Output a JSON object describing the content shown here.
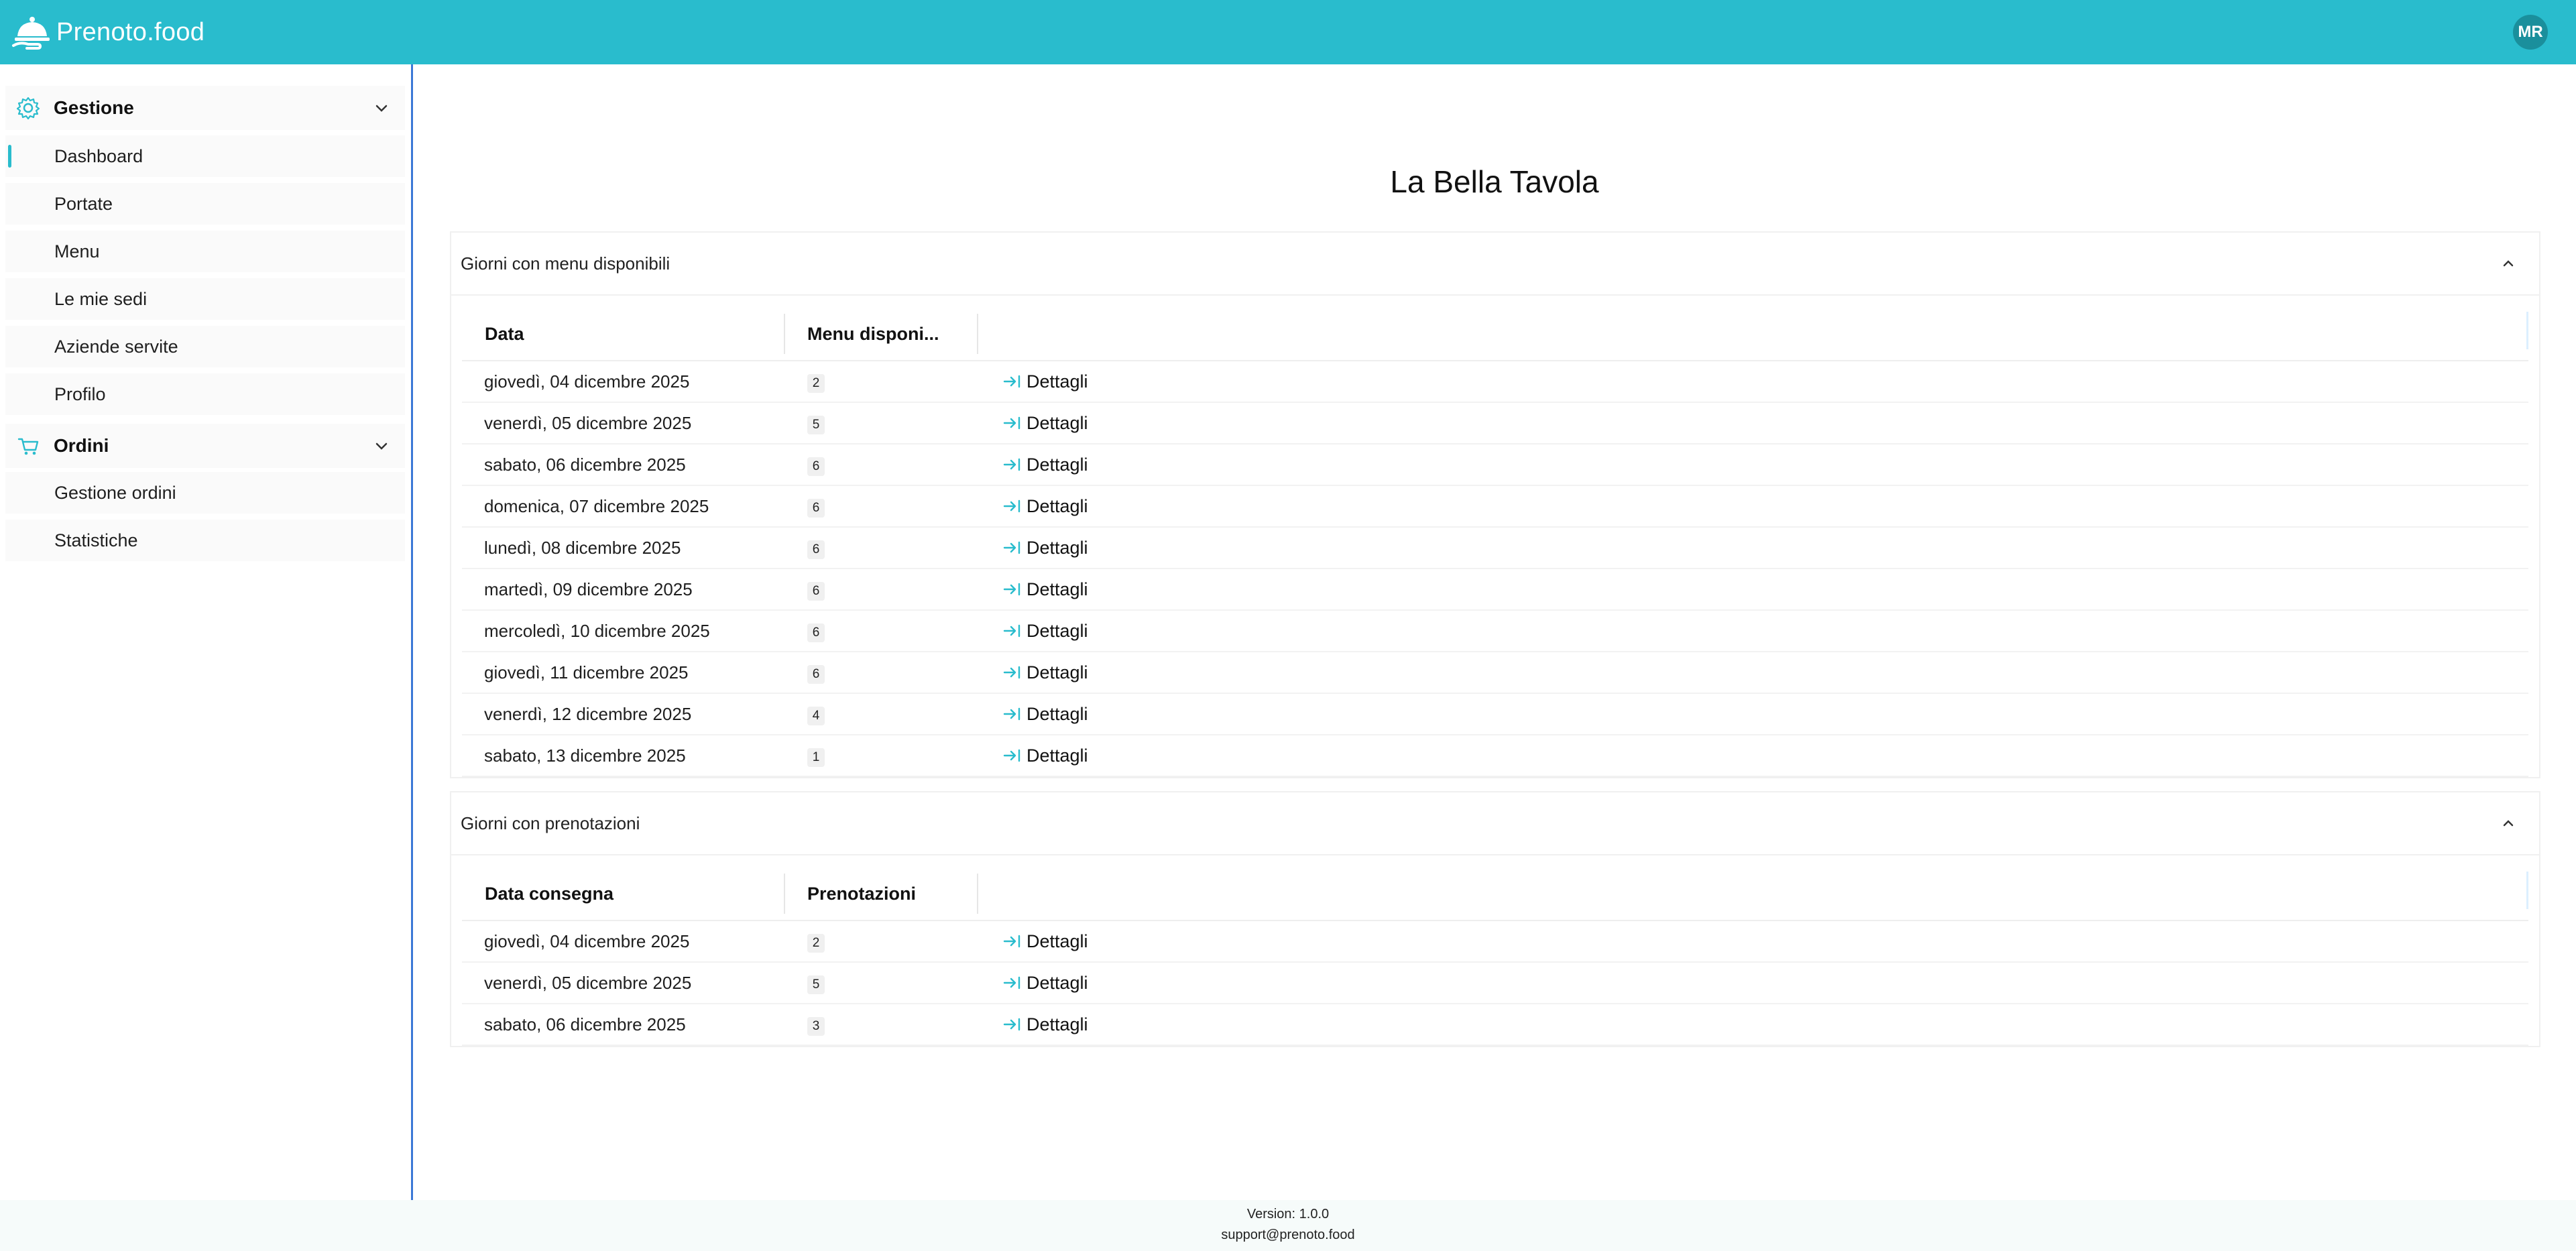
{
  "header": {
    "brand_name": "Prenoto.food",
    "avatar_initials": "MR",
    "color": "#29bccd"
  },
  "sidebar": {
    "groups": [
      {
        "label": "Gestione",
        "icon": "gear-icon",
        "items": [
          "Dashboard",
          "Portate",
          "Menu",
          "Le mie sedi",
          "Aziende servite",
          "Profilo"
        ]
      },
      {
        "label": "Ordini",
        "icon": "cart-icon",
        "items": [
          "Gestione ordini",
          "Statistiche"
        ]
      }
    ],
    "active_item": "Dashboard"
  },
  "main": {
    "title": "La Bella Tavola",
    "menu_panel": {
      "title": "Giorni con menu disponibili",
      "columns": [
        "Data",
        "Menu disponi..."
      ],
      "action_label": "Dettagli",
      "rows": [
        {
          "date": "giovedì, 04 dicembre 2025",
          "count": "2"
        },
        {
          "date": "venerdì, 05 dicembre 2025",
          "count": "5"
        },
        {
          "date": "sabato, 06 dicembre 2025",
          "count": "6"
        },
        {
          "date": "domenica, 07 dicembre 2025",
          "count": "6"
        },
        {
          "date": "lunedì, 08 dicembre 2025",
          "count": "6"
        },
        {
          "date": "martedì, 09 dicembre 2025",
          "count": "6"
        },
        {
          "date": "mercoledì, 10 dicembre 2025",
          "count": "6"
        },
        {
          "date": "giovedì, 11 dicembre 2025",
          "count": "6"
        },
        {
          "date": "venerdì, 12 dicembre 2025",
          "count": "4"
        },
        {
          "date": "sabato, 13 dicembre 2025",
          "count": "1"
        }
      ]
    },
    "reservations_panel": {
      "title": "Giorni con prenotazioni",
      "columns": [
        "Data consegna",
        "Prenotazioni"
      ],
      "action_label": "Dettagli",
      "rows": [
        {
          "date": "giovedì, 04 dicembre 2025",
          "count": "2"
        },
        {
          "date": "venerdì, 05 dicembre 2025",
          "count": "5"
        },
        {
          "date": "sabato, 06 dicembre 2025",
          "count": "3"
        }
      ]
    }
  },
  "footer": {
    "version": "Version: 1.0.0",
    "support": "support@prenoto.food"
  }
}
